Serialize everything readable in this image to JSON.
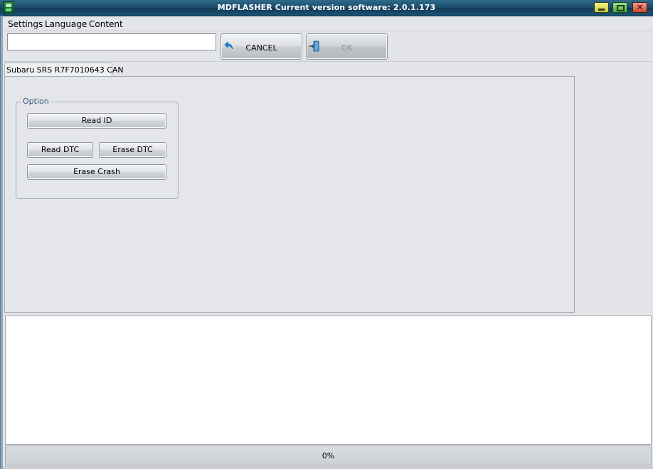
{
  "window": {
    "title": "MDFLASHER  Current version software: 2.0.1.173",
    "icons": {
      "app": "app-chip-icon",
      "minimize": "minimize-icon",
      "maximize": "maximize-icon",
      "close": "close-icon"
    },
    "close_glyph": "✕"
  },
  "menu": {
    "items": [
      {
        "label": "Settings"
      },
      {
        "label": "Language"
      },
      {
        "label": "Content"
      }
    ]
  },
  "toolbar": {
    "input_value": "",
    "cancel_label": "CANCEL",
    "ok_label": "OK",
    "ok_enabled": false,
    "icons": {
      "cancel": "undo-arrow-icon",
      "ok": "exit-door-icon"
    }
  },
  "tab": {
    "label": "Subaru SRS R7F7010643 CAN"
  },
  "option_group": {
    "legend": "Option",
    "buttons": {
      "read_id": "Read ID",
      "read_dtc": "Read DTC",
      "erase_dtc": "Erase DTC",
      "erase_crash": "Erase Crash"
    }
  },
  "log": {
    "text": ""
  },
  "progress": {
    "value": 0,
    "text": "0%"
  },
  "colors": {
    "title_bar": "#1a4a67",
    "background": "#e3e5e8",
    "accent_blue": "#1f7fd8"
  }
}
